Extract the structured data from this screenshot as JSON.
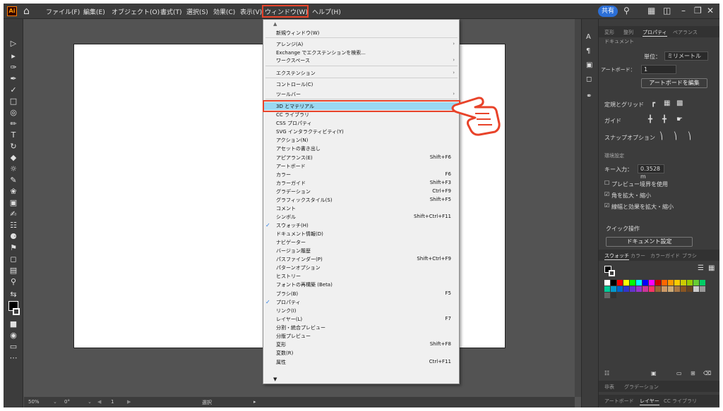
{
  "menubar": {
    "items": [
      "ファイル(F)",
      "編集(E)",
      "オブジェクト(O)",
      "書式(T)",
      "選択(S)",
      "効果(C)",
      "表示(V)",
      "ウィンドウ(W)",
      "ヘルプ(H)"
    ],
    "share": "共有"
  },
  "window_menu": {
    "items": [
      {
        "label": "新規ウィンドウ(W)",
        "shortcut": "",
        "sub": false,
        "check": false
      },
      {
        "label": "アレンジ(A)",
        "shortcut": "",
        "sub": true,
        "check": false
      },
      {
        "label": "Exchange でエクステンションを検索...",
        "shortcut": "",
        "sub": false,
        "check": false
      },
      {
        "label": "ワークスペース",
        "shortcut": "",
        "sub": true,
        "check": false
      },
      {
        "label": "エクステンション",
        "shortcut": "",
        "sub": true,
        "check": false
      },
      {
        "label": "コントロール(C)",
        "shortcut": "",
        "sub": false,
        "check": false
      },
      {
        "label": "ツールバー",
        "shortcut": "",
        "sub": true,
        "check": false
      },
      {
        "label": "3D とマテリアル",
        "shortcut": "",
        "sub": false,
        "check": false
      },
      {
        "label": "CC ライブラリ",
        "shortcut": "",
        "sub": false,
        "check": false
      },
      {
        "label": "CSS プロパティ",
        "shortcut": "",
        "sub": false,
        "check": false
      },
      {
        "label": "SVG インタラクティビティ(Y)",
        "shortcut": "",
        "sub": false,
        "check": false
      },
      {
        "label": "アクション(N)",
        "shortcut": "",
        "sub": false,
        "check": false
      },
      {
        "label": "アセットの書き出し",
        "shortcut": "",
        "sub": false,
        "check": false
      },
      {
        "label": "アピアランス(E)",
        "shortcut": "Shift+F6",
        "sub": false,
        "check": false
      },
      {
        "label": "アートボード",
        "shortcut": "",
        "sub": false,
        "check": false
      },
      {
        "label": "カラー",
        "shortcut": "F6",
        "sub": false,
        "check": false
      },
      {
        "label": "カラーガイド",
        "shortcut": "Shift+F3",
        "sub": false,
        "check": false
      },
      {
        "label": "グラデーション",
        "shortcut": "Ctrl+F9",
        "sub": false,
        "check": false
      },
      {
        "label": "グラフィックスタイル(S)",
        "shortcut": "Shift+F5",
        "sub": false,
        "check": false
      },
      {
        "label": "コメント",
        "shortcut": "",
        "sub": false,
        "check": false
      },
      {
        "label": "シンボル",
        "shortcut": "Shift+Ctrl+F11",
        "sub": false,
        "check": false
      },
      {
        "label": "スウォッチ(H)",
        "shortcut": "",
        "sub": false,
        "check": true
      },
      {
        "label": "ドキュメント情報(D)",
        "shortcut": "",
        "sub": false,
        "check": false
      },
      {
        "label": "ナビゲーター",
        "shortcut": "",
        "sub": false,
        "check": false
      },
      {
        "label": "バージョン履歴",
        "shortcut": "",
        "sub": false,
        "check": false
      },
      {
        "label": "パスファインダー(P)",
        "shortcut": "Shift+Ctrl+F9",
        "sub": false,
        "check": false
      },
      {
        "label": "パターンオプション",
        "shortcut": "",
        "sub": false,
        "check": false
      },
      {
        "label": "ヒストリー",
        "shortcut": "",
        "sub": false,
        "check": false
      },
      {
        "label": "フォントの再構築 (Beta)",
        "shortcut": "",
        "sub": false,
        "check": false
      },
      {
        "label": "ブラシ(B)",
        "shortcut": "F5",
        "sub": false,
        "check": false
      },
      {
        "label": "プロパティ",
        "shortcut": "",
        "sub": false,
        "check": true
      },
      {
        "label": "リンク(I)",
        "shortcut": "",
        "sub": false,
        "check": false
      },
      {
        "label": "レイヤー(L)",
        "shortcut": "F7",
        "sub": false,
        "check": false
      },
      {
        "label": "分割・統合プレビュー",
        "shortcut": "",
        "sub": false,
        "check": false
      },
      {
        "label": "分版プレビュー",
        "shortcut": "",
        "sub": false,
        "check": false
      },
      {
        "label": "変形",
        "shortcut": "Shift+F8",
        "sub": false,
        "check": false
      },
      {
        "label": "変数(R)",
        "shortcut": "",
        "sub": false,
        "check": false
      },
      {
        "label": "属性",
        "shortcut": "Ctrl+F11",
        "sub": false,
        "check": false
      }
    ]
  },
  "panel": {
    "tabs": [
      "変形",
      "整列",
      "プロパティ",
      "ペアランス"
    ],
    "doc_heading": "ドキュメント",
    "unit_label": "単位：",
    "unit_value": "ミリメートル",
    "artboard_label": "アートボード：",
    "artboard_value": "1",
    "edit_artboard": "アートボードを編集",
    "ruler_grid": "定規とグリッド",
    "guides": "ガイド",
    "snap": "スナップオプション",
    "prefs_heading": "環境設定",
    "key_input_label": "キー入力：",
    "key_input_value": "0.3528 m",
    "preview_bounds": "プレビュー境界を使用",
    "scale_corners": "角を拡大・縮小",
    "scale_strokes": "線幅と効果を拡大・縮小",
    "quick_actions": "クイック操作",
    "doc_setup": "ドキュメント設定",
    "swatch_tabs": [
      "スウォッチ",
      "カラー",
      "カラーガイド",
      "ブラシ"
    ],
    "bottom_tabs1": [
      "非表",
      "グラデーション"
    ],
    "bottom_tabs2": [
      "アートボード",
      "レイヤー",
      "CC ライブラリ"
    ]
  },
  "status": {
    "zoom": "50%",
    "angle": "0°",
    "page": "1",
    "mode": "選択"
  },
  "swatch_colors": [
    "#ffffff",
    "#000000",
    "#ff0000",
    "#ffff00",
    "#00ff00",
    "#00ffff",
    "#0000ff",
    "#ff00ff",
    "#cc0000",
    "#ff6600",
    "#ff9900",
    "#ffcc00",
    "#cccc00",
    "#99cc00",
    "#66cc33",
    "#00cc66",
    "#00cc99",
    "#0099cc",
    "#0066cc",
    "#3333cc",
    "#6633cc",
    "#9933cc",
    "#cc3399",
    "#ff3366",
    "#996633",
    "#cc9966",
    "#ccaa77",
    "#aa7744",
    "#885522",
    "#664422",
    "#cccccc",
    "#999999",
    "#666666",
    "#333333"
  ]
}
